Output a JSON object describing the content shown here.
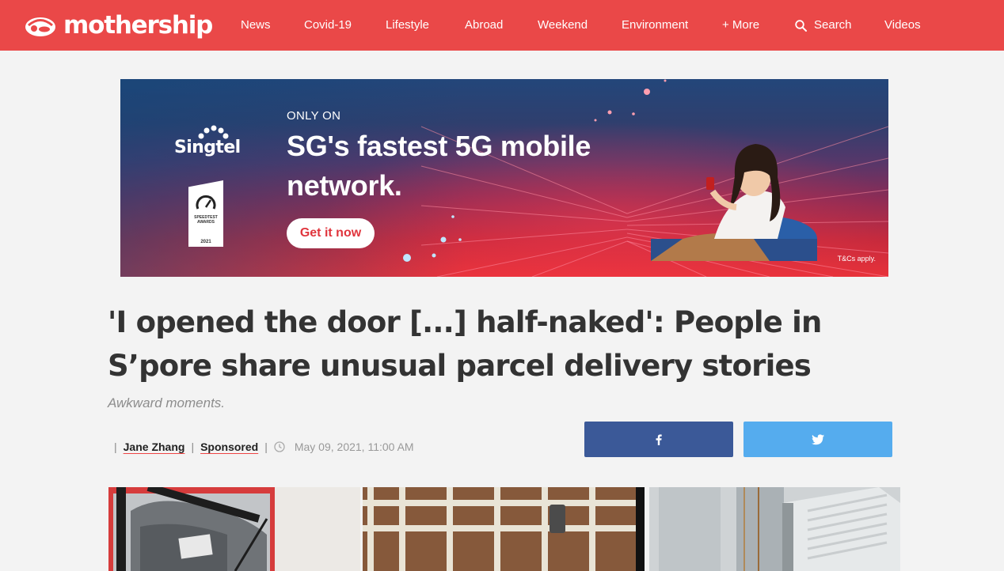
{
  "site": {
    "name": "mothership"
  },
  "nav": {
    "items": [
      {
        "label": "News"
      },
      {
        "label": "Covid-19"
      },
      {
        "label": "Lifestyle"
      },
      {
        "label": "Abroad"
      },
      {
        "label": "Weekend"
      },
      {
        "label": "Environment"
      },
      {
        "label": "+ More"
      },
      {
        "label": "Search",
        "icon": "search-icon"
      },
      {
        "label": "Videos"
      }
    ]
  },
  "ad": {
    "brand": "Singtel",
    "award_label": "SPEEDTEST AWARDS",
    "award_year": "2021",
    "eyebrow": "ONLY ON",
    "headline": "SG's fastest 5G mobile network.",
    "cta": "Get it now",
    "disclaimer": "T&Cs apply."
  },
  "article": {
    "title": "'I opened the door [...] half-naked': People in S’pore share unusual parcel delivery stories",
    "subtitle": "Awkward moments.",
    "author": "Jane Zhang",
    "tag": "Sponsored",
    "date": "May 09, 2021, 11:00 AM"
  },
  "share": {
    "facebook_icon": "facebook-icon",
    "twitter_icon": "twitter-icon"
  },
  "colors": {
    "nav_bg": "#ea4848",
    "facebook": "#3b5998",
    "twitter": "#55acee",
    "page_bg": "#f3f3f3"
  }
}
